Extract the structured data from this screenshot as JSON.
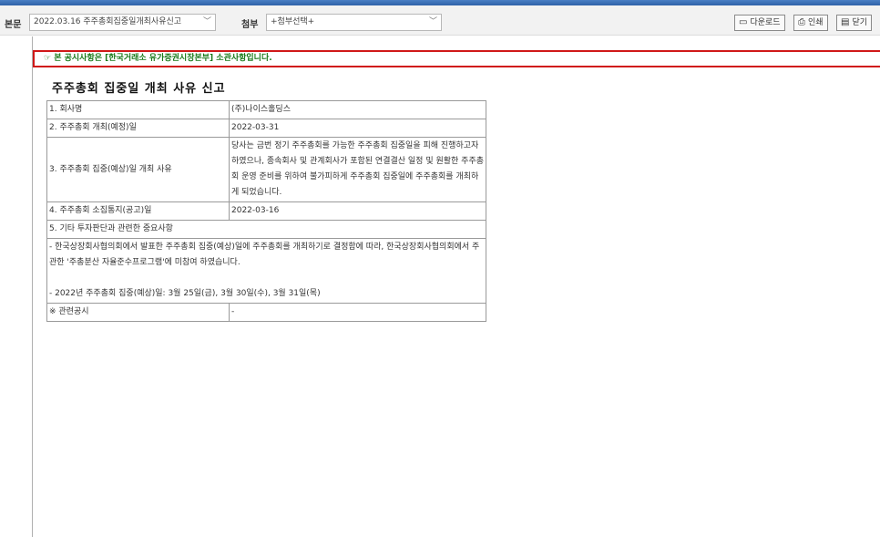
{
  "toolbar": {
    "body_label": "본문",
    "body_select_value": "2022.03.16  주주총회집중일개최사유신고",
    "attach_label": "첨부",
    "attach_select_value": "+첨부선택+",
    "download_label": "다운로드",
    "print_label": "인쇄",
    "close_label": "닫기"
  },
  "notice": "☞ 본 공시사항은 [한국거래소 유가증권시장본부] 소관사항입니다.",
  "document": {
    "title": "주주총회 집중일 개최 사유 신고",
    "rows": {
      "r1_label": "1. 회사명",
      "r1_value": "(주)나이스홀딩스",
      "r2_label": "2. 주주총회 개최(예정)일",
      "r2_value": "2022-03-31",
      "r3_label": "3. 주주총회 집중(예상)일 개최 사유",
      "r3_value": "당사는 금번 정기 주주총회를 가능한 주주총회 집중일을 피해 진행하고자 하였으나, 종속회사 및 관계회사가 포함된 연결결산 일정 및 원활한 주주총회 운영 준비를 위하여 불가피하게 주주총회 집중일에 주주총회를 개최하게 되었습니다.",
      "r4_label": "4. 주주총회 소집통지(공고)일",
      "r4_value": "2022-03-16",
      "r5_label": "5. 기타 투자판단과 관련한 중요사항",
      "r5_text1": "- 한국상장회사협의회에서 발표한 주주총회 집중(예상)일에 주주총회를 개최하기로 결정함에 따라, 한국상장회사협의회에서 주관한 '주총분산 자율준수프로그램'에 미참여 하였습니다.",
      "r5_text2": "- 2022년 주주총회 집중(예상)일: 3월 25일(금), 3월 30일(수), 3월 31일(목)",
      "r6_label": "※ 관련공시",
      "r6_value": "-"
    }
  }
}
